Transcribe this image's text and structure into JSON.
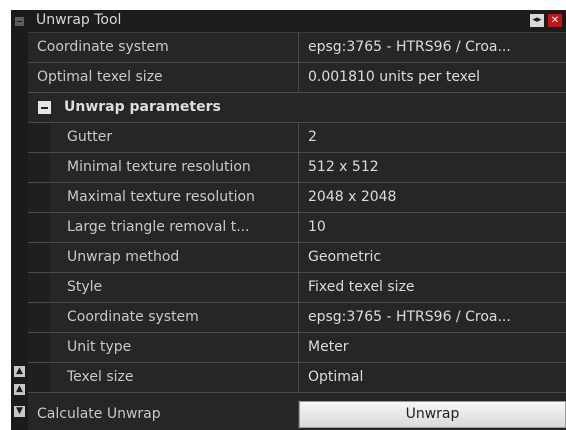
{
  "panel": {
    "title": "Unwrap Tool"
  },
  "top_rows": [
    {
      "label": "Coordinate system",
      "value": "epsg:3765 - HTRS96 / Croa..."
    },
    {
      "label": "Optimal texel size",
      "value": "0.001810 units per texel"
    }
  ],
  "group": {
    "label": "Unwrap parameters",
    "rows": [
      {
        "label": "Gutter",
        "value": "2"
      },
      {
        "label": "Minimal texture resolution",
        "value": "512 x 512"
      },
      {
        "label": "Maximal texture resolution",
        "value": "2048 x 2048"
      },
      {
        "label": "Large triangle removal t...",
        "value": "10"
      },
      {
        "label": "Unwrap method",
        "value": "Geometric"
      },
      {
        "label": "Style",
        "value": "Fixed texel size"
      },
      {
        "label": "Coordinate system",
        "value": "epsg:3765 - HTRS96 / Croa..."
      },
      {
        "label": "Unit type",
        "value": "Meter"
      },
      {
        "label": "Texel size",
        "value": "Optimal"
      }
    ]
  },
  "action": {
    "label": "Calculate Unwrap",
    "button": "Unwrap"
  },
  "icons": {
    "collapse": "minus-box-icon",
    "pin": "dock-pin-icon",
    "close": "close-icon",
    "scroll_up": "arrow-up-icon",
    "scroll_down": "arrow-down-icon"
  },
  "colors": {
    "close": "#c01818",
    "panel_bg": "#262626"
  }
}
